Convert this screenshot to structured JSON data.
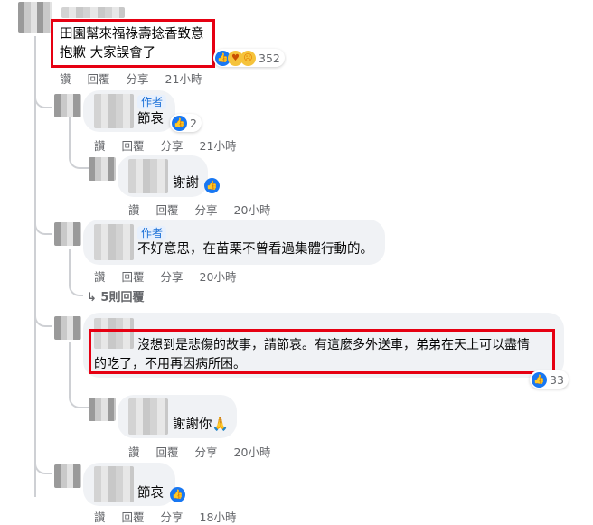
{
  "comments": [
    {
      "text_lines": [
        "田園幫來福祿壽捻香致意",
        "抱歉 大家誤會了"
      ],
      "actions": [
        "讚",
        "回覆",
        "分享"
      ],
      "time": "21小時",
      "reaction_count": "352"
    },
    {
      "badge": "作者",
      "text": "節哀",
      "actions": [
        "讚",
        "回覆",
        "分享"
      ],
      "time": "21小時",
      "reaction_count": "2"
    },
    {
      "text": "謝謝",
      "actions": [
        "讚",
        "回覆",
        "分享"
      ],
      "time": "20小時"
    },
    {
      "badge": "作者",
      "text": "不好意思，在苗栗不曾看過集體行動的。",
      "actions": [
        "讚",
        "回覆",
        "分享"
      ],
      "time": "20小時",
      "more_replies": "5則回覆"
    },
    {
      "text_lines": [
        "沒想到是悲傷的故事，請節哀。有這麼多外送車，弟弟在天上可以盡情",
        "的吃了，不用再因病所困。"
      ],
      "reaction_count": "33"
    },
    {
      "text": "謝謝你🙏",
      "actions": [
        "讚",
        "回覆",
        "分享"
      ],
      "time": "20小時"
    },
    {
      "text": "節哀",
      "actions": [
        "讚",
        "回覆",
        "分享"
      ],
      "time": "18小時"
    }
  ]
}
